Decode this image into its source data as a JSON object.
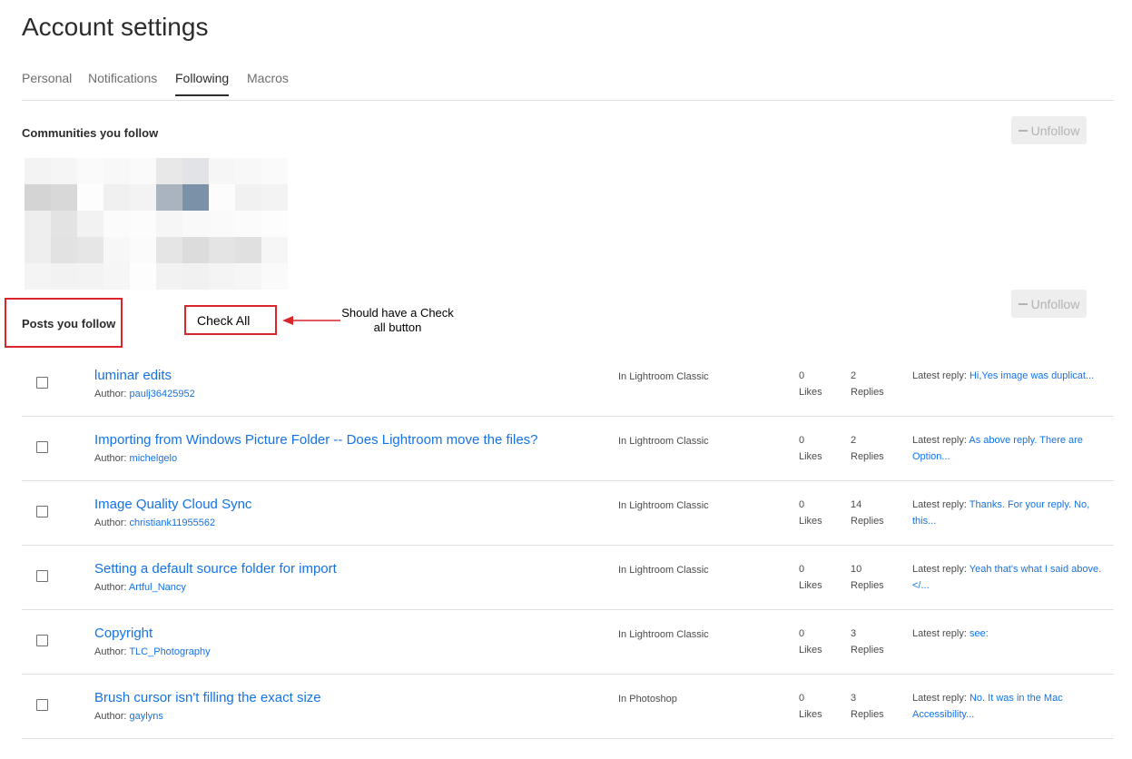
{
  "page": {
    "title": "Account settings"
  },
  "tabs": [
    {
      "label": "Personal",
      "active": false
    },
    {
      "label": "Notifications",
      "active": false
    },
    {
      "label": "Following",
      "active": true
    },
    {
      "label": "Macros",
      "active": false
    }
  ],
  "communities": {
    "title": "Communities you follow",
    "unfollow_label": "Unfollow"
  },
  "posts": {
    "title": "Posts you follow",
    "unfollow_label": "Unfollow",
    "author_prefix": "Author:",
    "likes_label": "Likes",
    "replies_label": "Replies",
    "latest_prefix": "Latest reply:",
    "items": [
      {
        "title": "luminar edits",
        "author": "paulj36425952",
        "board": "In Lightroom Classic",
        "likes": "0",
        "replies": "2",
        "latest": "Hi,Yes image was duplicat..."
      },
      {
        "title": "Importing from Windows Picture Folder -- Does Lightroom move the files?",
        "author": "michelgelo",
        "board": "In Lightroom Classic",
        "likes": "0",
        "replies": "2",
        "latest": "As above reply. There are Option..."
      },
      {
        "title": "Image Quality Cloud Sync",
        "author": "christiank11955562",
        "board": "In Lightroom Classic",
        "likes": "0",
        "replies": "14",
        "latest": "Thanks. For your reply. No, this..."
      },
      {
        "title": "Setting a default source folder for import",
        "author": "Artful_Nancy",
        "board": "In Lightroom Classic",
        "likes": "0",
        "replies": "10",
        "latest": "Yeah that's what I said above. </..."
      },
      {
        "title": "Copyright",
        "author": "TLC_Photography",
        "board": "In Lightroom Classic",
        "likes": "0",
        "replies": "3",
        "latest": "see:"
      },
      {
        "title": "Brush cursor isn't filling the exact size",
        "author": "gaylyns",
        "board": "In Photoshop",
        "likes": "0",
        "replies": "3",
        "latest": "No. It was in the Mac Accessibility..."
      }
    ]
  },
  "annotation": {
    "check_all_label": "Check All",
    "note": "Should have a Check all button"
  },
  "colors": {
    "accent": "#1473e6",
    "annotation": "#d9252b",
    "divider": "#e1e1e1"
  }
}
